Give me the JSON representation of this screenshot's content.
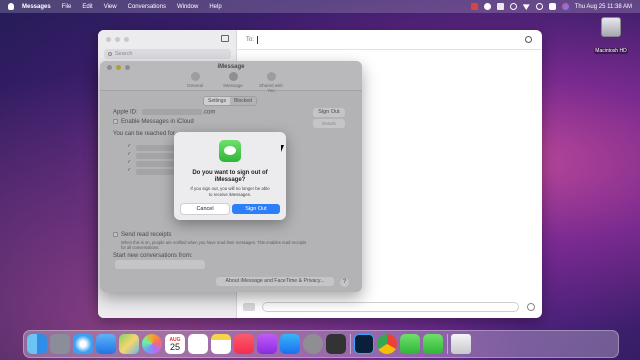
{
  "menubar": {
    "app_name": "Messages",
    "items": [
      "File",
      "Edit",
      "View",
      "Conversations",
      "Window",
      "Help"
    ],
    "clock": "Thu Aug 25  11:38 AM"
  },
  "desktop": {
    "disk_label": "Macintosh HD"
  },
  "messages": {
    "search_placeholder": "Search",
    "to_label": "To:"
  },
  "settings": {
    "title": "iMessage",
    "tabs": [
      "General",
      "iMessage",
      "Shared with You"
    ],
    "segments": [
      "Settings",
      "Blocked"
    ],
    "apple_id_label": "Apple ID:",
    "apple_id_suffix": ".com",
    "sign_out_label": "Sign Out",
    "details_label": "Details",
    "enable_icloud_label": "Enable Messages in iCloud",
    "reached_label": "You can be reached for",
    "read_receipts_label": "Send read receipts",
    "read_receipts_note_1": "When this is on, people are notified when you have read their messages. This enables read receipts",
    "read_receipts_note_2": "for all conversations.",
    "start_from_label": "Start new conversations from:",
    "about_button": "About iMessage and FaceTime & Privacy...",
    "help_label": "?"
  },
  "alert": {
    "title_line1": "Do you want to sign out of",
    "title_line2": "iMessage?",
    "body_line1": "If you sign out, you will no longer be able",
    "body_line2": "to receive iMessages.",
    "cancel": "Cancel",
    "confirm": "Sign Out"
  },
  "dock": {
    "calendar_month": "AUG",
    "calendar_day": "25",
    "icons": [
      "finder-icon",
      "launchpad-icon",
      "safari-icon",
      "mail-icon",
      "maps-icon",
      "photos-icon",
      "calendar-icon",
      "reminders-icon",
      "notes-icon",
      "music-icon",
      "podcasts-icon",
      "appstore-icon",
      "system-preferences-icon",
      "calculator-icon",
      "photoshop-icon",
      "chrome-icon",
      "messages-icon",
      "facetime-icon",
      "trash-icon"
    ]
  },
  "colors": {
    "accent": "#2d7ff9",
    "messages_green": "#34c759"
  }
}
